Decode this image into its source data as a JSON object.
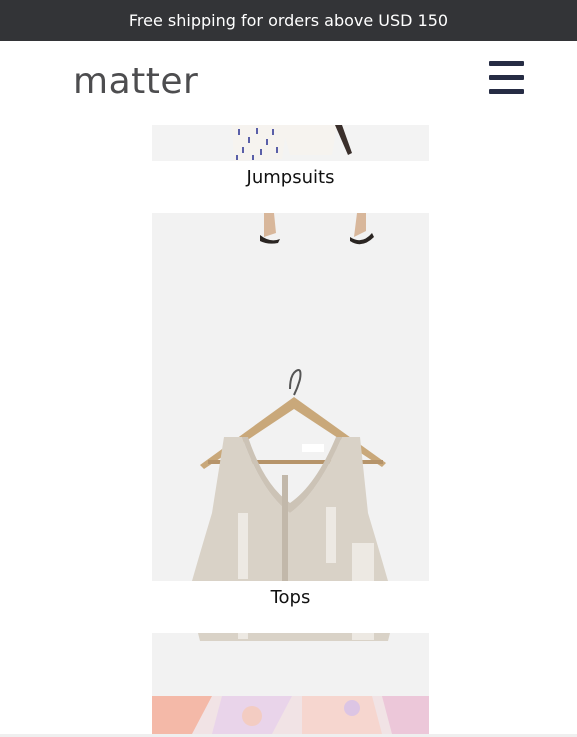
{
  "announcement": {
    "text": "Free shipping for orders above USD 150"
  },
  "header": {
    "logo": "matter",
    "menu_icon": "hamburger-menu-icon"
  },
  "categories": [
    {
      "label": "Jumpsuits",
      "image": "jumpsuit-photo"
    },
    {
      "label": "Tops",
      "image": "tops-photo"
    }
  ],
  "colors": {
    "announce_bg": "#333437",
    "logo": "#4d4d4f",
    "menu_icon": "#262c44",
    "photo_bg": "#f2f2f2"
  }
}
